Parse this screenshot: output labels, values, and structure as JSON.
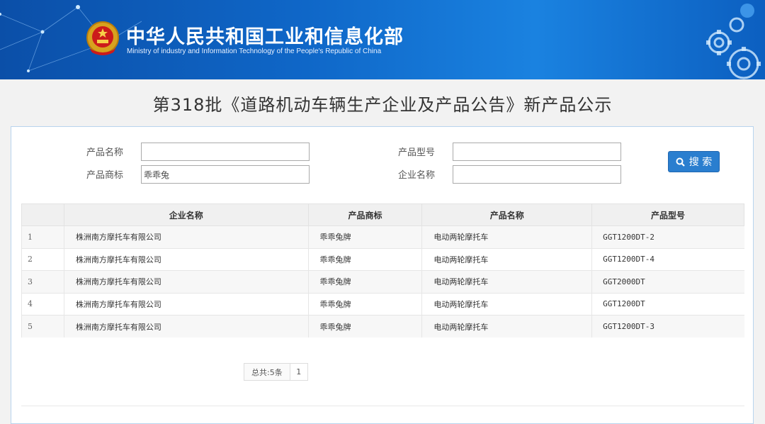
{
  "header": {
    "title_cn": "中华人民共和国工业和信息化部",
    "title_en": "Ministry of industry and Information Technology of the People's Republic of China"
  },
  "page_title": "第318批《道路机动车辆生产企业及产品公告》新产品公示",
  "search": {
    "product_name_label": "产品名称",
    "product_name_value": "",
    "product_model_label": "产品型号",
    "product_model_value": "",
    "brand_label": "产品商标",
    "brand_value": "乖乖兔",
    "company_label": "企业名称",
    "company_value": "",
    "button_label": "搜 索"
  },
  "table": {
    "headers": [
      "",
      "企业名称",
      "产品商标",
      "产品名称",
      "产品型号"
    ],
    "rows": [
      {
        "num": "1",
        "company": "株洲南方摩托车有限公司",
        "brand": "乖乖兔牌",
        "name": "电动两轮摩托车",
        "model": "GGT1200DT-2"
      },
      {
        "num": "2",
        "company": "株洲南方摩托车有限公司",
        "brand": "乖乖兔牌",
        "name": "电动两轮摩托车",
        "model": "GGT1200DT-4"
      },
      {
        "num": "3",
        "company": "株洲南方摩托车有限公司",
        "brand": "乖乖兔牌",
        "name": "电动两轮摩托车",
        "model": "GGT2000DT"
      },
      {
        "num": "4",
        "company": "株洲南方摩托车有限公司",
        "brand": "乖乖兔牌",
        "name": "电动两轮摩托车",
        "model": "GGT1200DT"
      },
      {
        "num": "5",
        "company": "株洲南方摩托车有限公司",
        "brand": "乖乖兔牌",
        "name": "电动两轮摩托车",
        "model": "GGT1200DT-3"
      }
    ]
  },
  "pagination": {
    "total": "总共:5条",
    "current_page": "1"
  },
  "colors": {
    "header_blue": "#0f67c8",
    "button_blue": "#2a7ecf"
  },
  "icons": {
    "emblem": "national-emblem-icon",
    "search": "search-icon",
    "gears": "gears-icon"
  }
}
